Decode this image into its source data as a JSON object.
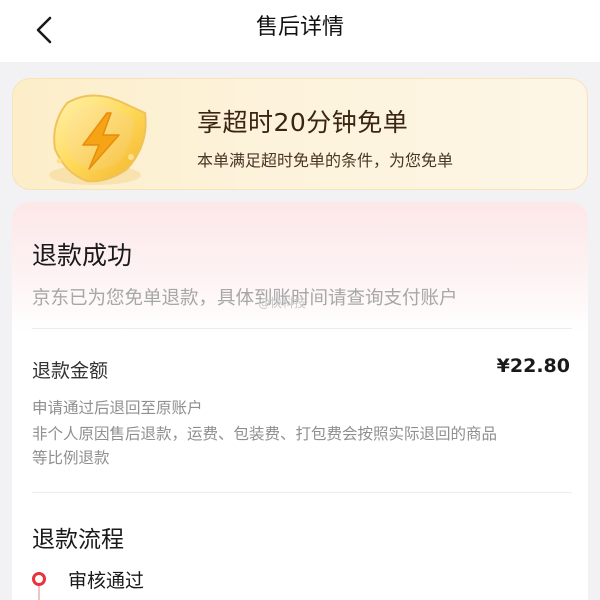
{
  "nav": {
    "title": "售后详情"
  },
  "promo": {
    "title": "享超时20分钟免单",
    "subtitle": "本单满足超时免单的条件，为您免单",
    "icon": "lightning-shield-icon"
  },
  "refund": {
    "status_title": "退款成功",
    "status_desc": "京东已为您免单退款，具体到账时间请查询支付账户",
    "amount_label": "退款金额",
    "amount_value": "¥22.80",
    "notes": [
      "申请通过后退回至原账户",
      "非个人原因售后退款，运费、包装费、打包费会按照实际退回的商品",
      "等比例退款"
    ]
  },
  "flow": {
    "title": "退款流程",
    "steps": [
      {
        "label": "审核通过",
        "status": "done"
      }
    ]
  },
  "watermark": "@快科技",
  "colors": {
    "accent_red": "#e8323c",
    "promo_bg": "#fdeec9",
    "muted_text": "#a7a7a7"
  }
}
